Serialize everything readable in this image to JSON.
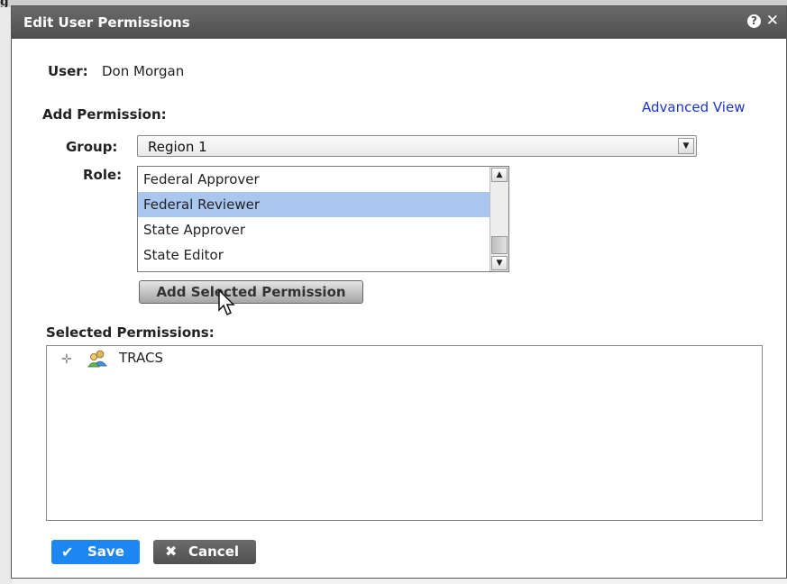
{
  "background": {
    "corner_glyph": "g"
  },
  "dialog": {
    "title": "Edit User Permissions",
    "icons": {
      "help": "help-icon",
      "close": "close-icon"
    }
  },
  "user": {
    "label": "User:",
    "name": "Don Morgan"
  },
  "add_permission": {
    "heading": "Add Permission:",
    "advanced_link": "Advanced View",
    "group": {
      "label": "Group:",
      "selected": "Region 1"
    },
    "role": {
      "label": "Role:",
      "options": [
        "Federal Approver",
        "Federal Reviewer",
        "State Approver",
        "State Editor"
      ],
      "selected": "Federal Reviewer"
    },
    "add_button": "Add Selected Permission"
  },
  "selected_permissions": {
    "heading": "Selected Permissions:",
    "tree": [
      {
        "label": "TRACS",
        "icon": "user-group-icon",
        "expanded": false
      }
    ]
  },
  "footer": {
    "save": "Save",
    "cancel": "Cancel"
  },
  "colors": {
    "title_bar": "#555555",
    "link": "#1a33cc",
    "selected_row": "#a9c6ee",
    "save_button": "#1e86f0",
    "cancel_button": "#5e5e5e"
  }
}
